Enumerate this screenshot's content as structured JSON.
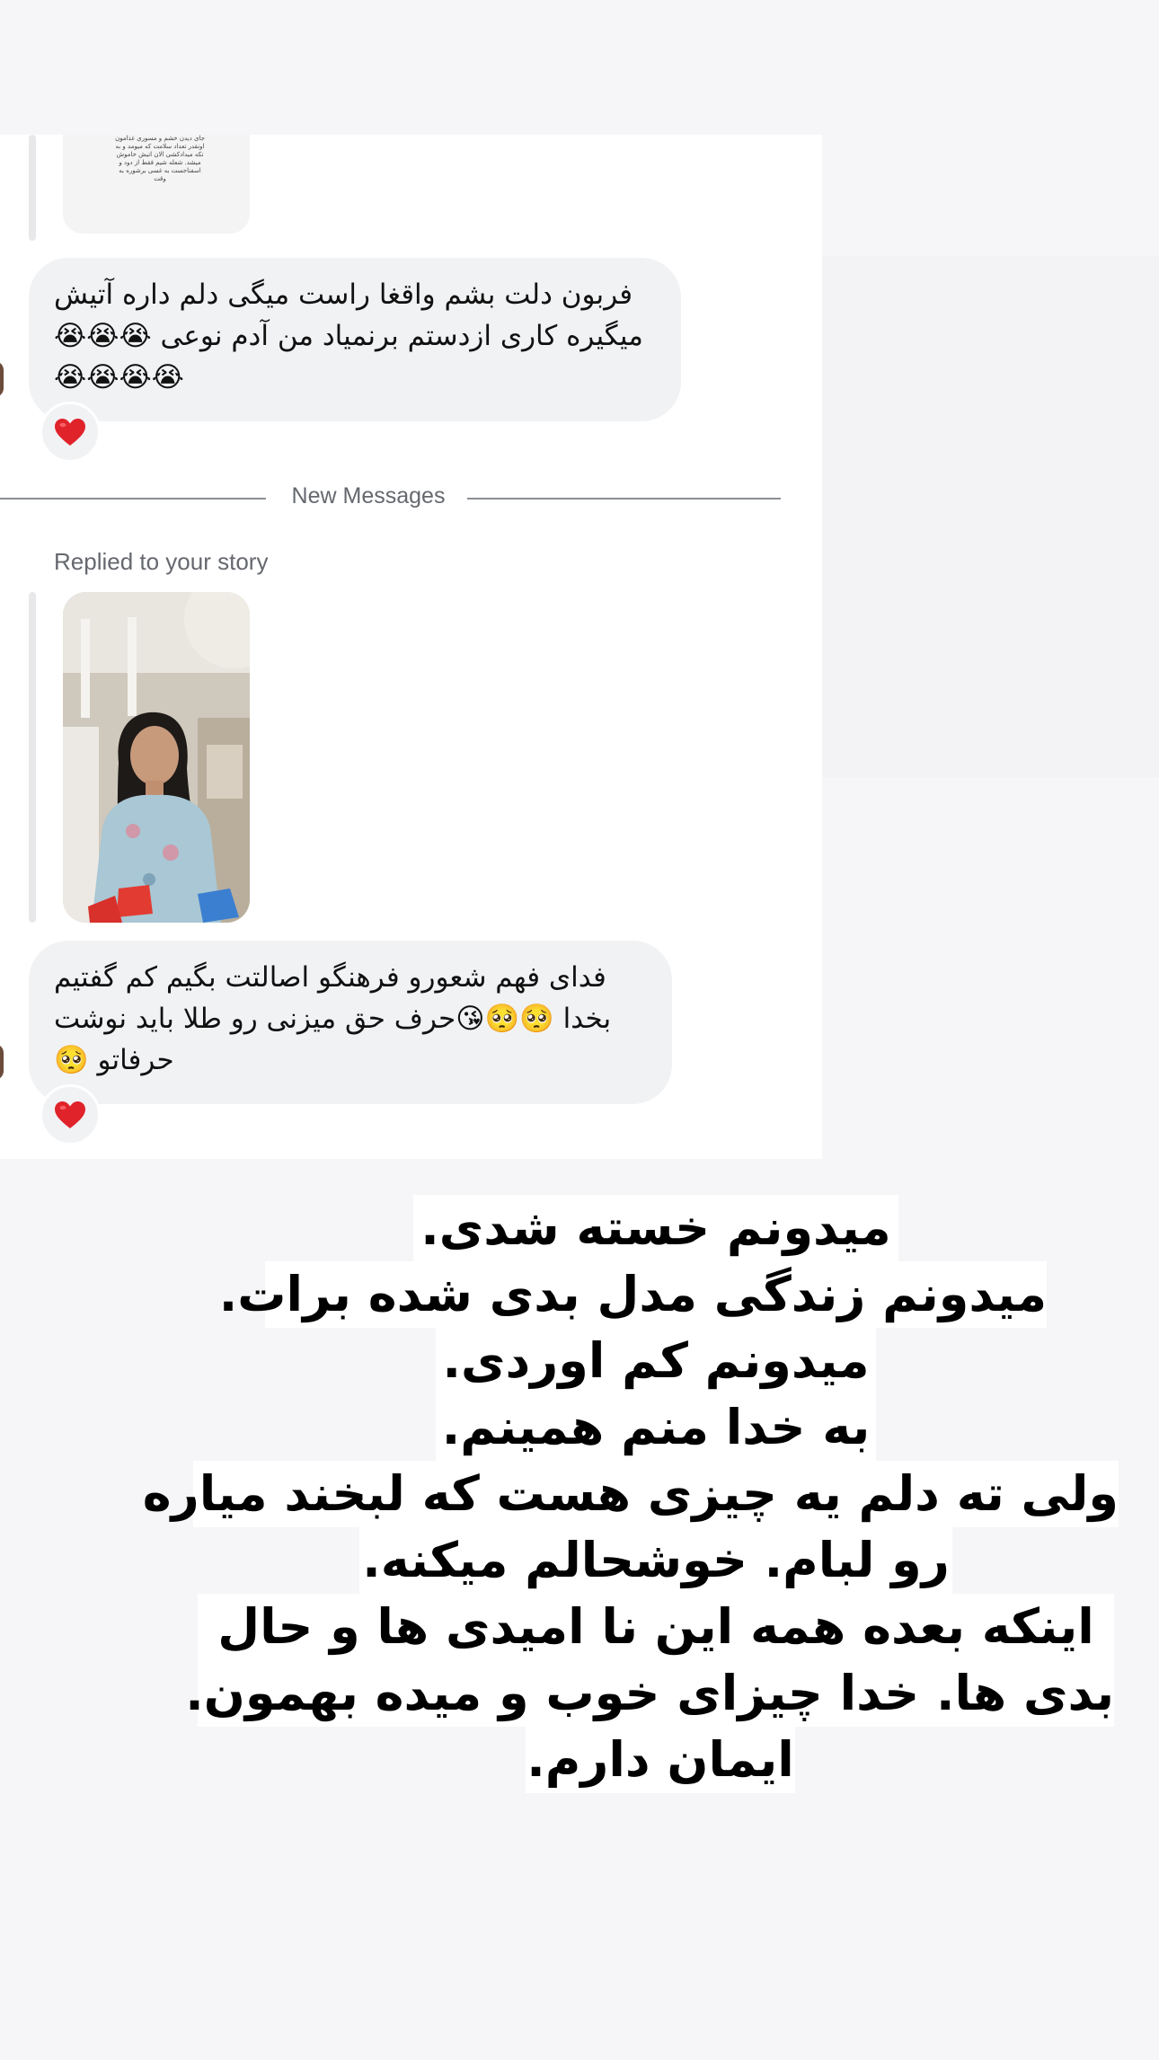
{
  "top_story": {
    "tiny_text": "جای دیدن خشم و مسوری غذامون اونقدر تعداد سلامت که میومد و به تکه میدادکشی الان اتیش خاموش میشد. شعله شیم فقط از دود و اسفناجست به غسی برشوره به وقت"
  },
  "messages": [
    {
      "text": "فربون دلت بشم واقغا راست میگی دلم داره آتیش میگیره کاری ازدستم برنمیاد من آدم نوعی 😭😭😭😭😭😭😭",
      "reaction": "❤️"
    },
    {
      "reply_label": "Replied to your story",
      "text": "فدای فهم شعورو فرهنگو اصالتت بگیم کم گفتیم  بخدا 🥺🥺😘حرف حق میزنی رو طلا باید نوشت حرفاتو 🥺",
      "reaction": "❤️"
    }
  ],
  "divider": {
    "label": "New Messages"
  },
  "story_caption": {
    "lines": [
      "میدونم خسته شدی.",
      "میدونم زندگی مدل بدی شده برات.",
      "میدونم کم اوردی.",
      "به خدا منم همینم.",
      "ولی ته دلم یه چیزی هست که لبخند میاره",
      "رو لبام. خوشحالم میکنه.",
      "اینکه بعده همه این نا امیدی ها و حال",
      "بدی ها. خدا چیزای خوب و میده بهمون.",
      "ایمان دارم."
    ]
  },
  "colors": {
    "bubble": "#f1f2f4",
    "muted_text": "#65686e",
    "heart": "#e0232a"
  },
  "icons": {
    "reaction": "heart-icon"
  }
}
